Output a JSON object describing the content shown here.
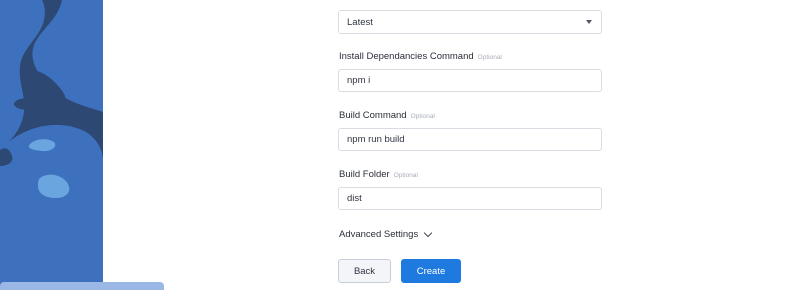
{
  "version_select": {
    "value": "Latest"
  },
  "install_command": {
    "label": "Install Dependancies Command",
    "optional": "Optional",
    "value": "npm i"
  },
  "build_command": {
    "label": "Build Command",
    "optional": "Optional",
    "value": "npm run build"
  },
  "build_folder": {
    "label": "Build Folder",
    "optional": "Optional",
    "value": "dist"
  },
  "advanced": {
    "label": "Advanced Settings"
  },
  "actions": {
    "back_label": "Back",
    "create_label": "Create"
  },
  "colors": {
    "primary": "#1f7ae0",
    "side_dark": "#2d4873",
    "side_mid": "#3e71bd",
    "side_light": "#6aa5e0"
  },
  "icons": {
    "select_caret": "caret-down-icon",
    "advanced_toggle": "chevron-down-icon"
  }
}
